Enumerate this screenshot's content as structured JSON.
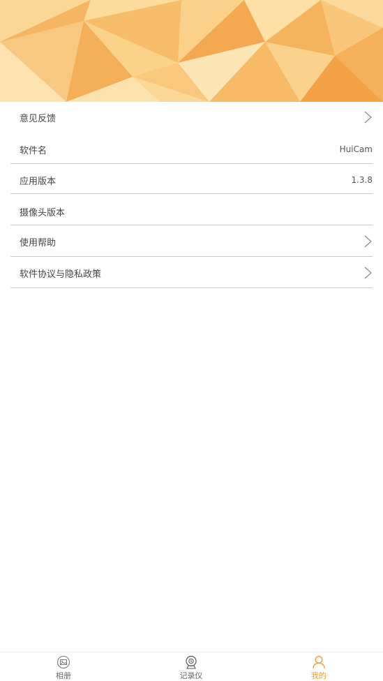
{
  "theme": {
    "accent": "#f19a2c",
    "banner_colors": [
      "#f6b760",
      "#f9cf85",
      "#fbe1a8",
      "#f3a64a"
    ]
  },
  "settings": {
    "items": [
      {
        "label": "意见反馈",
        "value": "",
        "icon": "chevron-right-icon"
      },
      {
        "label": "软件名",
        "value": "HuiCam",
        "icon": ""
      },
      {
        "label": "应用版本",
        "value": "1.3.8",
        "icon": ""
      },
      {
        "label": "摄像头版本",
        "value": "",
        "icon": ""
      },
      {
        "label": "使用帮助",
        "value": "",
        "icon": "chevron-right-icon"
      },
      {
        "label": "软件协议与隐私政策",
        "value": "",
        "icon": "chevron-right-icon"
      }
    ]
  },
  "tabbar": {
    "tabs": [
      {
        "label": "相册",
        "icon": "album-icon",
        "active": false
      },
      {
        "label": "记录仪",
        "icon": "dashcam-icon",
        "active": false
      },
      {
        "label": "我的",
        "icon": "profile-icon",
        "active": true
      }
    ]
  }
}
